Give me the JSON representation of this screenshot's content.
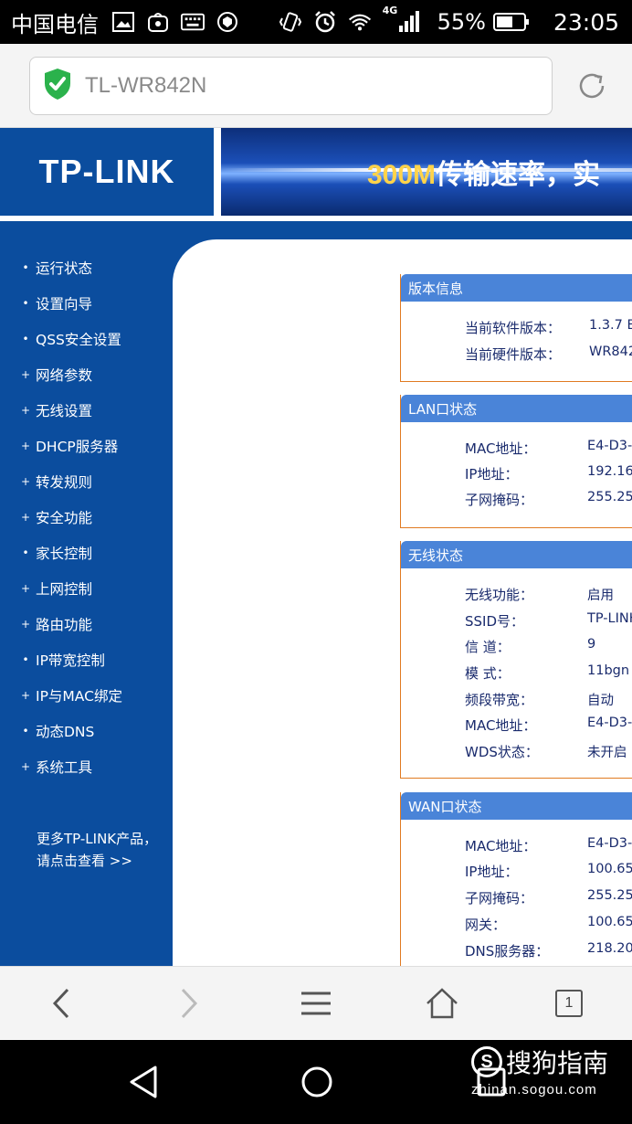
{
  "status_bar": {
    "carrier": "中国电信",
    "network": "4G",
    "battery": "55%",
    "time": "23:05",
    "icons": [
      "image-icon",
      "bag-icon",
      "keyboard-icon",
      "shield-app-icon",
      "vibrate-icon",
      "alarm-icon",
      "wifi-icon",
      "signal-icon",
      "battery-icon"
    ]
  },
  "browser": {
    "url": "TL-WR842N",
    "tab_count": "1"
  },
  "banner": {
    "logo": "TP-LINK",
    "slogan_highlight": "300M",
    "slogan_text": "传输速率，实"
  },
  "sidebar": {
    "items": [
      {
        "label": "运行状态",
        "bullet": "•"
      },
      {
        "label": "设置向导",
        "bullet": "•"
      },
      {
        "label": "QSS安全设置",
        "bullet": "•"
      },
      {
        "label": "网络参数",
        "bullet": "+"
      },
      {
        "label": "无线设置",
        "bullet": "+"
      },
      {
        "label": "DHCP服务器",
        "bullet": "+"
      },
      {
        "label": "转发规则",
        "bullet": "+"
      },
      {
        "label": "安全功能",
        "bullet": "+"
      },
      {
        "label": "家长控制",
        "bullet": "•"
      },
      {
        "label": "上网控制",
        "bullet": "+"
      },
      {
        "label": "路由功能",
        "bullet": "+"
      },
      {
        "label": "IP带宽控制",
        "bullet": "•"
      },
      {
        "label": "IP与MAC绑定",
        "bullet": "+"
      },
      {
        "label": "动态DNS",
        "bullet": "•"
      },
      {
        "label": "系统工具",
        "bullet": "+"
      }
    ],
    "more_line1": "更多TP-LINK产品，",
    "more_line2": "请点击查看 >>"
  },
  "panels": {
    "version": {
      "title": "版本信息",
      "rows": [
        {
          "label": "当前软件版本：",
          "value": "1.3.7 B"
        },
        {
          "label": "当前硬件版本：",
          "value": "WR842"
        }
      ]
    },
    "lan": {
      "title": "LAN口状态",
      "rows": [
        {
          "label": "MAC地址：",
          "value": "E4-D3-3"
        },
        {
          "label": "IP地址：",
          "value": "192.168"
        },
        {
          "label": "子网掩码：",
          "value": "255.25"
        }
      ]
    },
    "wireless": {
      "title": "无线状态",
      "rows": [
        {
          "label": "无线功能：",
          "value": "启用"
        },
        {
          "label": "SSID号：",
          "value": "TP-LINK"
        },
        {
          "label": "信 道：",
          "value": "9"
        },
        {
          "label": "模 式：",
          "value": "11bgn"
        },
        {
          "label": "频段带宽：",
          "value": "自动"
        },
        {
          "label": "MAC地址：",
          "value": "E4-D3-3"
        },
        {
          "label": "WDS状态：",
          "value": "未开启"
        }
      ]
    },
    "wan": {
      "title": "WAN口状态",
      "rows": [
        {
          "label": "MAC地址：",
          "value": "E4-D3-3"
        },
        {
          "label": "IP地址：",
          "value": "100.65."
        },
        {
          "label": "子网掩码：",
          "value": "255.255"
        },
        {
          "label": "网关：",
          "value": "100.65."
        },
        {
          "label": "DNS服务器：",
          "value": "218.20"
        }
      ]
    }
  },
  "watermark": {
    "logo_letter": "S",
    "title": "搜狗指南",
    "url": "zhinan.sogou.com"
  },
  "colors": {
    "router_blue": "#0b4d9e",
    "panel_header": "#4a84d8",
    "panel_border": "#e07a21",
    "label_text": "#1a2b6d",
    "secure_green": "#2bb24c"
  }
}
